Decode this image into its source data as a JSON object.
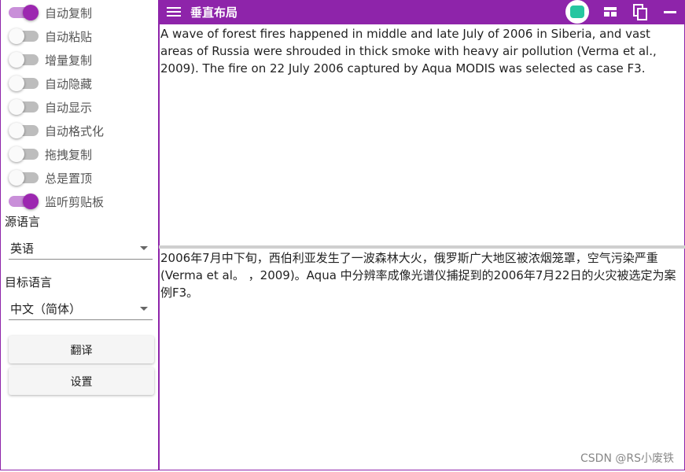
{
  "toggles": [
    {
      "label": "自动复制",
      "on": true
    },
    {
      "label": "自动粘贴",
      "on": false
    },
    {
      "label": "增量复制",
      "on": false
    },
    {
      "label": "自动隐藏",
      "on": false
    },
    {
      "label": "自动显示",
      "on": false
    },
    {
      "label": "自动格式化",
      "on": false
    },
    {
      "label": "拖拽复制",
      "on": false
    },
    {
      "label": "总是置顶",
      "on": false
    },
    {
      "label": "监听剪贴板",
      "on": true
    }
  ],
  "source_language": {
    "label": "源语言",
    "value": "英语"
  },
  "target_language": {
    "label": "目标语言",
    "value": "中文（简体）"
  },
  "buttons": {
    "translate": "翻译",
    "settings": "设置"
  },
  "topbar": {
    "title": "垂直布局",
    "accent": "#8e24aa"
  },
  "source_text": "A wave of forest fires happened in middle and late July of 2006 in Siberia, and vast areas of Russia were shrouded in thick smoke with heavy air pollution (Verma et al., 2009). The fire on 22 July 2006 captured by Aqua MODIS was selected as case F3.",
  "translated_text": "2006年7月中下旬，西伯利亚发生了一波森林大火，俄罗斯广大地区被浓烟笼罩，空气污染严重(Verma et al。 ，2009)。Aqua 中分辨率成像光谱仪捕捉到的2006年7月22日的火灾被选定为案例F3。",
  "watermark": "CSDN @RS小废铁"
}
